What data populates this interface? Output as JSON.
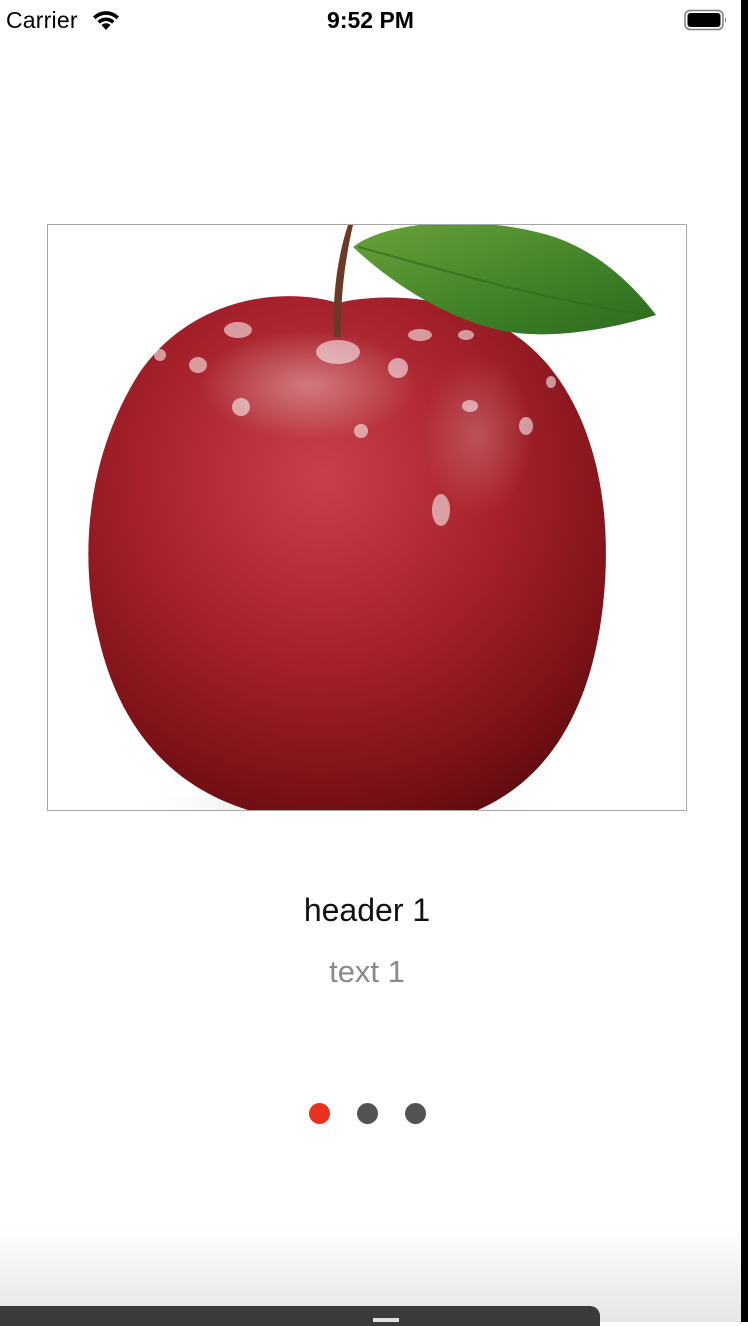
{
  "status_bar": {
    "carrier": "Carrier",
    "time": "9:52 PM",
    "wifi_icon": "wifi-icon",
    "battery_icon": "battery-icon"
  },
  "slide": {
    "image_icon": "apple-photo",
    "header": "header 1",
    "text": "text 1"
  },
  "pager": {
    "count": 3,
    "active_index": 0,
    "active_color": "#e8311f",
    "inactive_color": "#525252"
  },
  "colors": {
    "background": "#ffffff",
    "header_text": "#111111",
    "body_text": "#8a8a8a"
  }
}
